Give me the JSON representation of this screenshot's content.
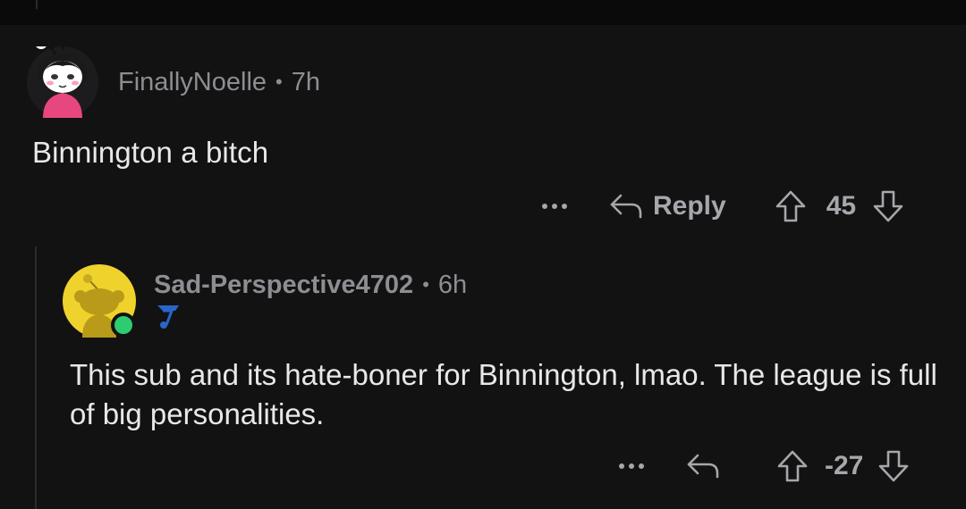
{
  "comments": [
    {
      "author": "FinallyNoelle",
      "separator": "•",
      "age": "7h",
      "body": "Binnington a bitch",
      "actions": {
        "more": "•••",
        "reply_label": "Reply",
        "score": "45"
      },
      "avatar_icon": "snoo-avatar-pink-hoodie"
    },
    {
      "author": "Sad-Perspective4702",
      "separator": "•",
      "age": "6h",
      "body": "This sub and its hate-boner for Binnington, lmao. The league is full of big personalities.",
      "actions": {
        "more": "•••",
        "score": "-27"
      },
      "avatar_icon": "default-snoo-avatar-yellow",
      "online": true,
      "flair_icon": "blues-note-flair-icon"
    }
  ],
  "colors": {
    "background": "#121213",
    "meta_text": "#8d8d92",
    "body_text": "#e8e8ea",
    "action_text": "#a6a6ab",
    "online_green": "#2ecc71",
    "avatar_yellow": "#f0d22c",
    "avatar_pink": "#e8467f"
  }
}
